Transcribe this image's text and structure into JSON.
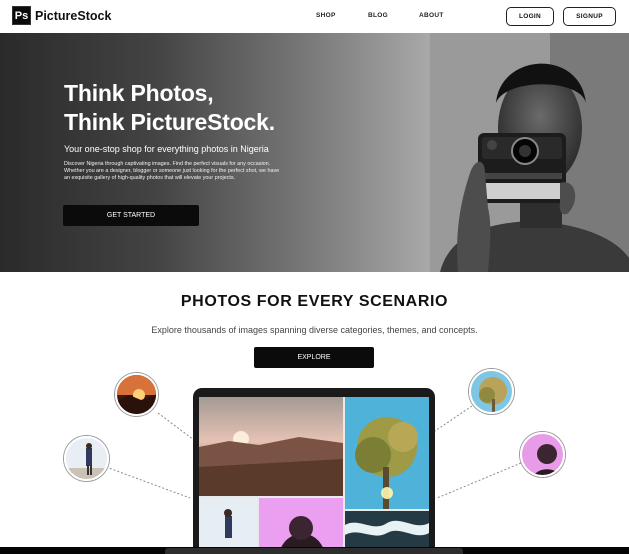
{
  "nav": {
    "logo_mark": "Ps",
    "logo_text": "PictureStock",
    "links": [
      "SHOP",
      "BLOG",
      "ABOUT"
    ],
    "login": "LOGIN",
    "signup": "SIGNUP"
  },
  "hero": {
    "headline_1": "Think Photos,",
    "headline_2": "Think PictureStock.",
    "subtitle": "Your one-stop shop for everything photos in Nigeria",
    "description": "Discover Nigeria through captivating images. Find the perfect visuals for any occasion. Whether you are a designer, blogger or someone just looking for the perfect shot, we have an exquisite gallery of high-quality photos that will elevate your projects.",
    "cta": "GET STARTED"
  },
  "scenario": {
    "title": "PHOTOS FOR EVERY SCENARIO",
    "subtitle": "Explore thousands of images spanning diverse categories, themes, and concepts.",
    "cta": "EXPLORE"
  },
  "colors": {
    "button_bg": "#0b0b0b",
    "text": "#111111",
    "muted": "#444444"
  },
  "icons": {
    "logo": "ps-logo-icon"
  }
}
